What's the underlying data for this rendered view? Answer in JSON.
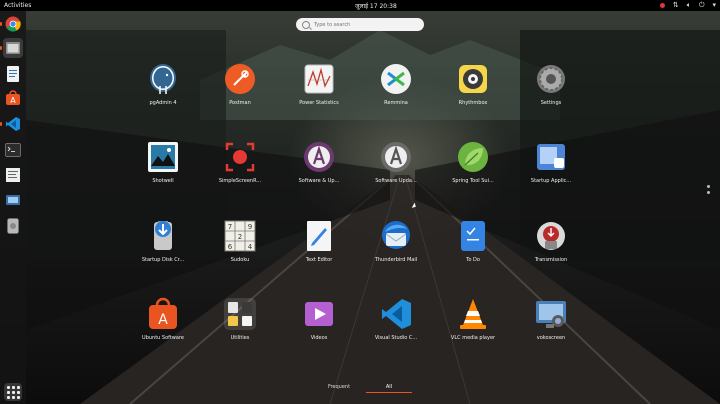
{
  "topbar": {
    "activities": "Activities",
    "clock": "जुलाई 17  20:38"
  },
  "search": {
    "placeholder": "Type to search"
  },
  "apps": [
    {
      "label": "pgAdmin 4",
      "icon": "elephant-icon"
    },
    {
      "label": "Postman",
      "icon": "postman-icon"
    },
    {
      "label": "Power Statistics",
      "icon": "power-stats-icon"
    },
    {
      "label": "Remmina",
      "icon": "remmina-icon"
    },
    {
      "label": "Rhythmbox",
      "icon": "rhythmbox-icon"
    },
    {
      "label": "Settings",
      "icon": "gear-icon"
    },
    {
      "label": "Shotwell",
      "icon": "shotwell-icon"
    },
    {
      "label": "SimpleScreenR...",
      "icon": "screen-recorder-icon"
    },
    {
      "label": "Software & Up...",
      "icon": "software-updates-icon"
    },
    {
      "label": "Software Upda...",
      "icon": "software-updater-icon"
    },
    {
      "label": "Spring Tool Sui...",
      "icon": "spring-leaf-icon"
    },
    {
      "label": "Startup Applic...",
      "icon": "startup-apps-icon"
    },
    {
      "label": "Startup Disk Cr...",
      "icon": "startup-disk-icon"
    },
    {
      "label": "Sudoku",
      "icon": "sudoku-icon"
    },
    {
      "label": "Text Editor",
      "icon": "text-editor-icon"
    },
    {
      "label": "Thunderbird Mail",
      "icon": "thunderbird-icon"
    },
    {
      "label": "To Do",
      "icon": "todo-icon"
    },
    {
      "label": "Transmission",
      "icon": "transmission-icon"
    },
    {
      "label": "Ubuntu Software",
      "icon": "ubuntu-software-icon"
    },
    {
      "label": "Utilities",
      "icon": "utilities-folder-icon"
    },
    {
      "label": "Videos",
      "icon": "videos-icon"
    },
    {
      "label": "Visual Studio C...",
      "icon": "vscode-icon"
    },
    {
      "label": "VLC media player",
      "icon": "vlc-icon"
    },
    {
      "label": "vokoscreen",
      "icon": "vokoscreen-icon"
    }
  ],
  "tabs": {
    "frequent": "Frequent",
    "all": "All"
  },
  "colors": {
    "accent": "#e95420",
    "topbar": "#000000"
  }
}
